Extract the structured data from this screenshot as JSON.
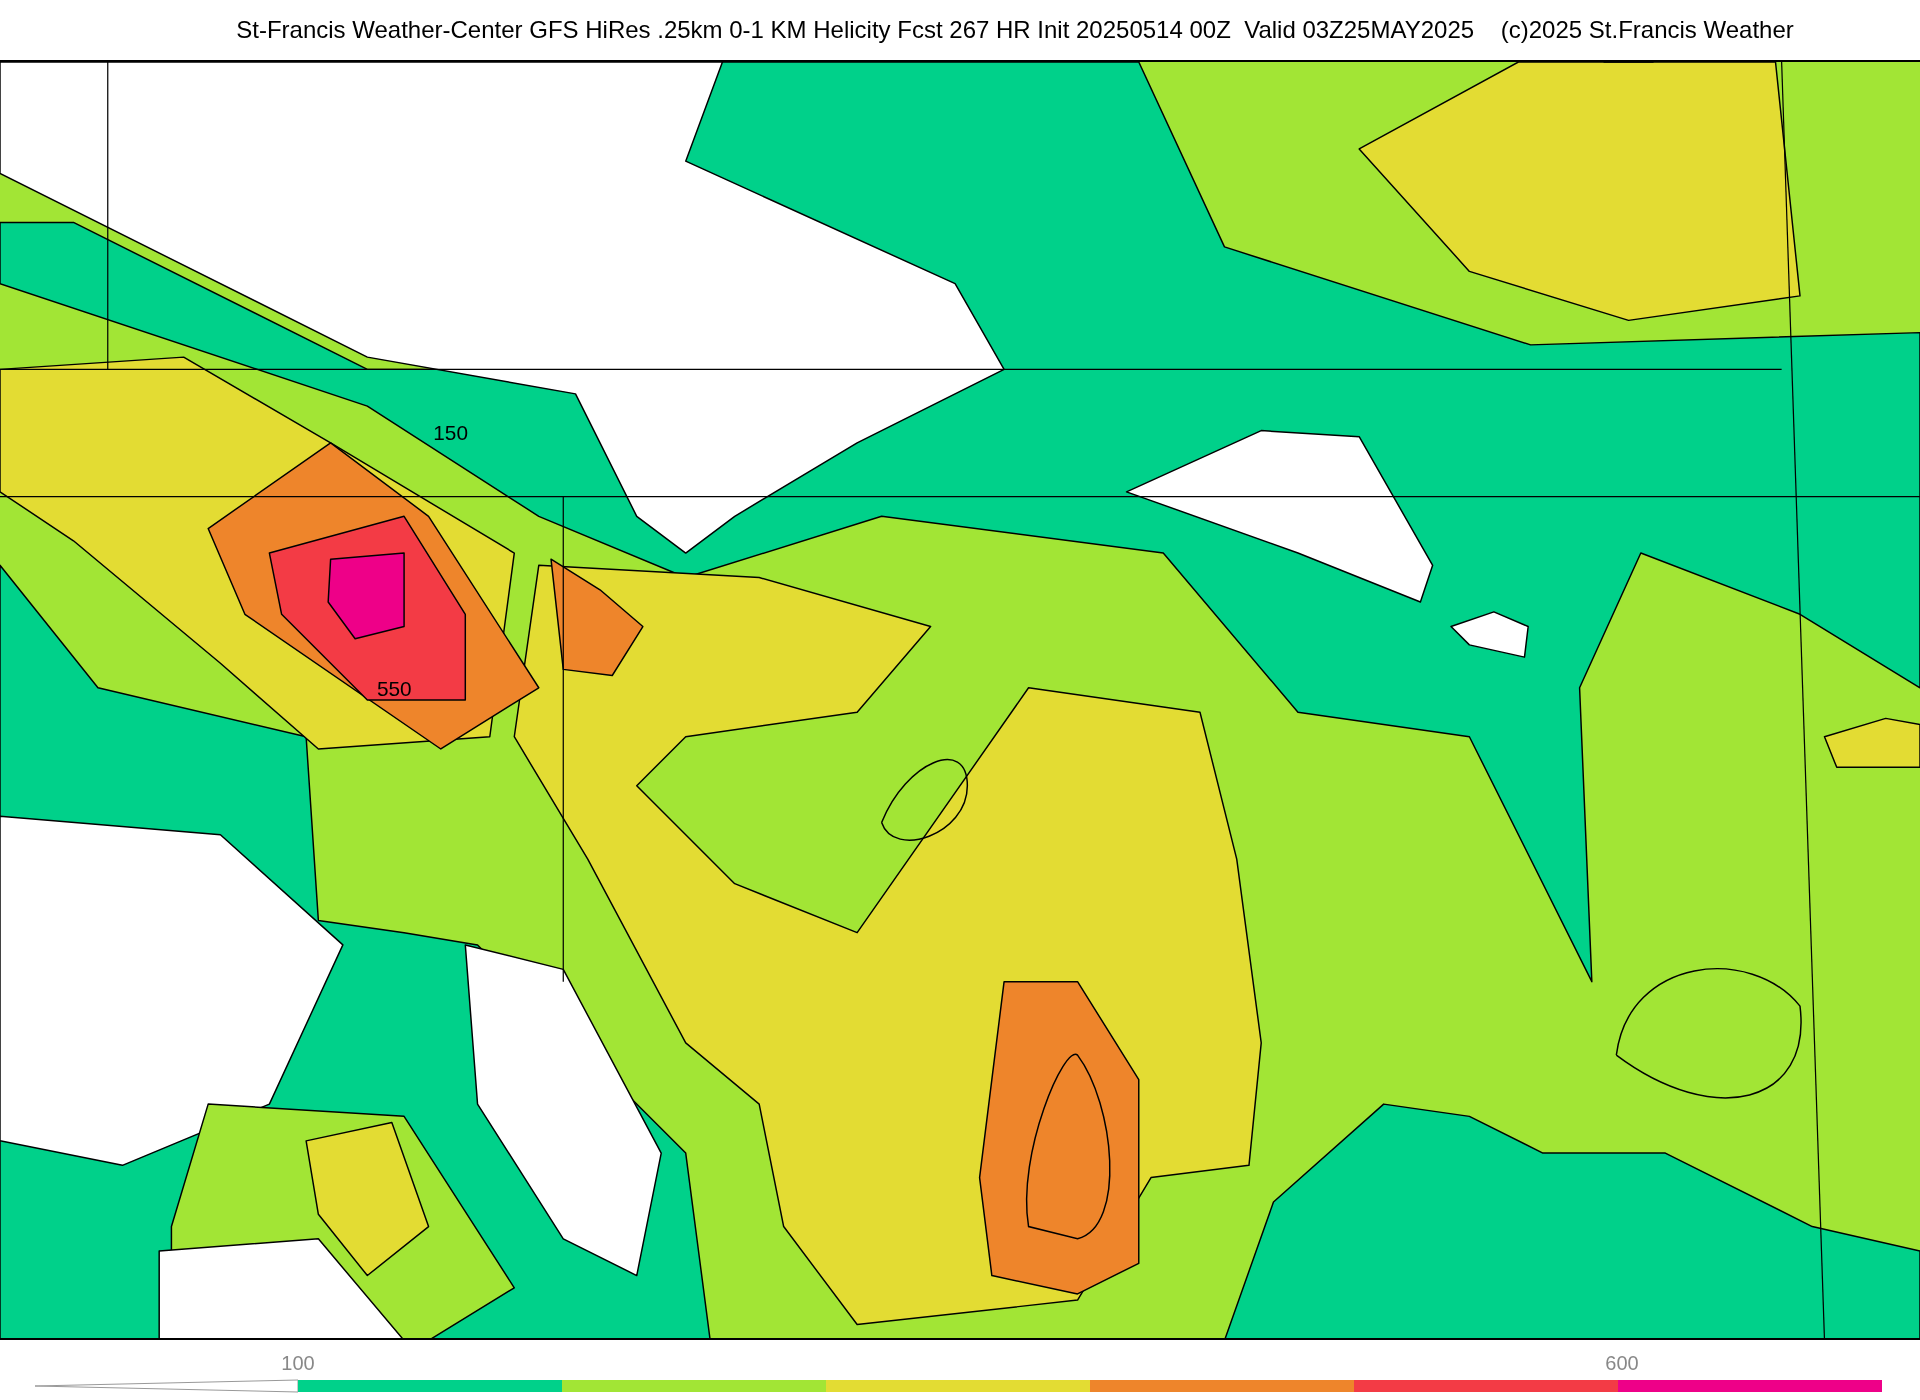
{
  "title": "St-Francis Weather-Center GFS HiRes .25km 0-1 KM Helicity Fcst 267 HR Init 20250514 00Z  Valid 03Z25MAY2025    (c)2025 St.Francis Weather",
  "map": {
    "contour_labels": [
      "150",
      "550"
    ]
  },
  "colorbar": {
    "labels": [
      "100",
      "600"
    ],
    "segments": [
      {
        "color": "#00d18a"
      },
      {
        "color": "#a2e535"
      },
      {
        "color": "#e3dc33"
      },
      {
        "color": "#ee852b"
      },
      {
        "color": "#f33b45"
      },
      {
        "color": "#ee0088"
      }
    ]
  }
}
